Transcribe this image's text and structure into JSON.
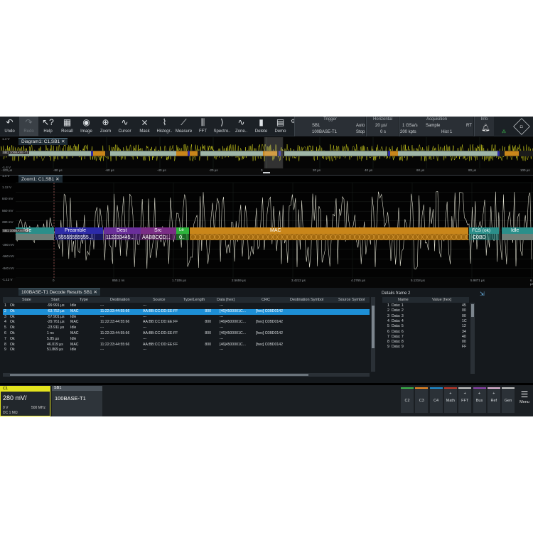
{
  "toolbar": {
    "buttons": [
      {
        "label": "Undo",
        "icon": "↶"
      },
      {
        "label": "Redo",
        "icon": "↷"
      },
      {
        "label": "Help",
        "icon": "↖?"
      },
      {
        "label": "Recall",
        "icon": "▦"
      },
      {
        "label": "Image",
        "icon": "◉"
      },
      {
        "label": "Zoom",
        "icon": "⊕"
      },
      {
        "label": "Cursor",
        "icon": "∿"
      },
      {
        "label": "Mask",
        "icon": "⨯"
      },
      {
        "label": "Histogr..",
        "icon": "⌇"
      },
      {
        "label": "Measure",
        "icon": "⟋"
      },
      {
        "label": "FFT",
        "icon": "⫼"
      },
      {
        "label": "Spectro..",
        "icon": "⟩"
      },
      {
        "label": "Zone..",
        "icon": "∿"
      },
      {
        "label": "Delete",
        "icon": "▮"
      },
      {
        "label": "Demo",
        "icon": "▤"
      }
    ],
    "trigger": {
      "title": "Trigger",
      "source": "SB1",
      "mode": "Auto",
      "protocol": "100BASE-T1",
      "state": "Stop"
    },
    "horizontal": {
      "title": "Horizontal",
      "scale": "20 µs/",
      "position": "0 s"
    },
    "acquisition": {
      "title": "Acquisition",
      "rate": "1 GSa/s",
      "mode": "Sample",
      "rt": "RT",
      "points": "200 kpts",
      "hist": "Hist 1"
    },
    "info": {
      "title": "Info"
    }
  },
  "diagram1": {
    "tab": "Diagram1: C1,SB1",
    "ylabels": [
      "1.4 V",
      "-1.4 V"
    ],
    "bus_label": "SB1 100BASE-T1",
    "xlabels": [
      "-100 µs",
      "-80 µs",
      "-60 µs",
      "-40 µs",
      "-20 µs",
      "0",
      "20 µs",
      "40 µs",
      "60 µs",
      "80 µs",
      "100 µs"
    ]
  },
  "zoom1": {
    "tab": "Zoom1: C1,SB1",
    "ylabels": [
      "1.4 V",
      "1.12 V",
      "840 mV",
      "560 mV",
      "280 mV",
      "0",
      "-280 mV",
      "-560 mV",
      "-840 mV",
      "-1.12 V",
      "-1.4 V"
    ],
    "xlabels": [
      "0",
      "855.1 ns",
      "1.7106 µs",
      "2.5659 µs",
      "3.4212 µs",
      "4.2765 µs",
      "5.1318 µs",
      "5.9871 µs",
      "6.8424 µs"
    ],
    "bus_label": "SB1 100BASE-T1",
    "segments": {
      "idle1": "Idle",
      "preamble": "Preamble",
      "preamble_val": "55555555555...",
      "dest": "Dest",
      "dest_val": "112233445...",
      "src": "Src",
      "src_val": "AABBCCD...",
      "tl": "Le",
      "tl_val": "0..",
      "mac": "MAC",
      "fcs": "FCS (ok)",
      "fcs_val": "C0BD",
      "idle2": "Idle"
    }
  },
  "decode": {
    "tab": "100BASE-T1 Decode Results SB1",
    "columns": [
      "State",
      "Start",
      "Type",
      "Destination",
      "Source",
      "Type/Length",
      "Data [hex]",
      "CRC",
      "Destination Symbol",
      "Source Symbol"
    ],
    "rows": [
      {
        "idx": "1",
        "state": "Ok",
        "start": "-99.991 µs",
        "type": "Idle",
        "dest": "---",
        "src": "---",
        "tl": "",
        "data": "---",
        "crc": ""
      },
      {
        "idx": "2",
        "state": "Ok",
        "start": "-63.752 µs",
        "type": "MAC",
        "dest": "11:22:33:44:55:66",
        "src": "AA:BB:CC:DD:EE:FF",
        "tl": "800",
        "data": "[46]4500001C...",
        "crc": "[hex] C0BD0142"
      },
      {
        "idx": "3",
        "state": "Ok",
        "start": "-57.901 µs",
        "type": "Idle",
        "dest": "---",
        "src": "---",
        "tl": "",
        "data": "---",
        "crc": ""
      },
      {
        "idx": "4",
        "state": "Ok",
        "start": "-29.761 µs",
        "type": "MAC",
        "dest": "11:22:33:44:55:66",
        "src": "AA:BB:CC:DD:EE:FF",
        "tl": "800",
        "data": "[46]4500001C...",
        "crc": "[hex] C0BD0142"
      },
      {
        "idx": "5",
        "state": "Ok",
        "start": "-23.911 µs",
        "type": "Idle",
        "dest": "---",
        "src": "---",
        "tl": "",
        "data": "---",
        "crc": ""
      },
      {
        "idx": "6",
        "state": "Ok",
        "start": "1 ns",
        "type": "MAC",
        "dest": "11:22:33:44:55:66",
        "src": "AA:BB:CC:DD:EE:FF",
        "tl": "800",
        "data": "[46]4500001C...",
        "crc": "[hex] C0BD0142"
      },
      {
        "idx": "7",
        "state": "Ok",
        "start": "5.85 µs",
        "type": "Idle",
        "dest": "---",
        "src": "---",
        "tl": "",
        "data": "---",
        "crc": ""
      },
      {
        "idx": "8",
        "state": "Ok",
        "start": "46.019 µs",
        "type": "MAC",
        "dest": "11:22:33:44:55:66",
        "src": "AA:BB:CC:DD:EE:FF",
        "tl": "800",
        "data": "[46]4500001C...",
        "crc": "[hex] C0BD0142"
      },
      {
        "idx": "9",
        "state": "Ok",
        "start": "51.869 µs",
        "type": "Idle",
        "dest": "---",
        "src": "---",
        "tl": "",
        "data": "---",
        "crc": ""
      }
    ],
    "selected_row": 1
  },
  "details": {
    "title": "Details frame 2",
    "columns": [
      "Name",
      "Value [hex]"
    ],
    "rows": [
      {
        "idx": "1",
        "name": "Data: 1",
        "value": "45"
      },
      {
        "idx": "2",
        "name": "Data: 2",
        "value": "00"
      },
      {
        "idx": "3",
        "name": "Data: 3",
        "value": "00"
      },
      {
        "idx": "4",
        "name": "Data: 4",
        "value": "1C"
      },
      {
        "idx": "5",
        "name": "Data: 5",
        "value": "12"
      },
      {
        "idx": "6",
        "name": "Data: 6",
        "value": "34"
      },
      {
        "idx": "7",
        "name": "Data: 7",
        "value": "40"
      },
      {
        "idx": "8",
        "name": "Data: 8",
        "value": "00"
      },
      {
        "idx": "9",
        "name": "Data: 9",
        "value": "FF"
      }
    ]
  },
  "channel_c1": {
    "name": "C1",
    "scale": "280 mV/",
    "offset": "0 V",
    "bw": "500 MHz",
    "coupling": "DC 1 MΩ"
  },
  "serial_bus": {
    "name": "SB1",
    "protocol": "100BASE-T1"
  },
  "bottom_buttons": [
    {
      "plus": "",
      "label": "C2",
      "color": "#3bb54a"
    },
    {
      "plus": "",
      "label": "C3",
      "color": "#f08a24"
    },
    {
      "plus": "",
      "label": "C4",
      "color": "#1e90d6"
    },
    {
      "plus": "+",
      "label": "Math",
      "color": "#c0392b"
    },
    {
      "plus": "+",
      "label": "FFT",
      "color": "#c7c7c7"
    },
    {
      "plus": "+",
      "label": "Bus",
      "color": "#8e44ad"
    },
    {
      "plus": "+",
      "label": "Ref",
      "color": "#e5b8d8"
    },
    {
      "plus": "",
      "label": "Gen",
      "color": "#c7c7c7"
    }
  ],
  "menu": {
    "label": "Menu"
  },
  "colors": {
    "c1": "#e3e31e",
    "idle": "#2a8f8a",
    "preamble": "#2c2aa8",
    "dest": "#6a2e9a",
    "src": "#7b2d86",
    "tl": "#2db53c",
    "mac": "#c9861a",
    "fcs": "#2a8f8a",
    "accent": "#1d8fd6"
  }
}
